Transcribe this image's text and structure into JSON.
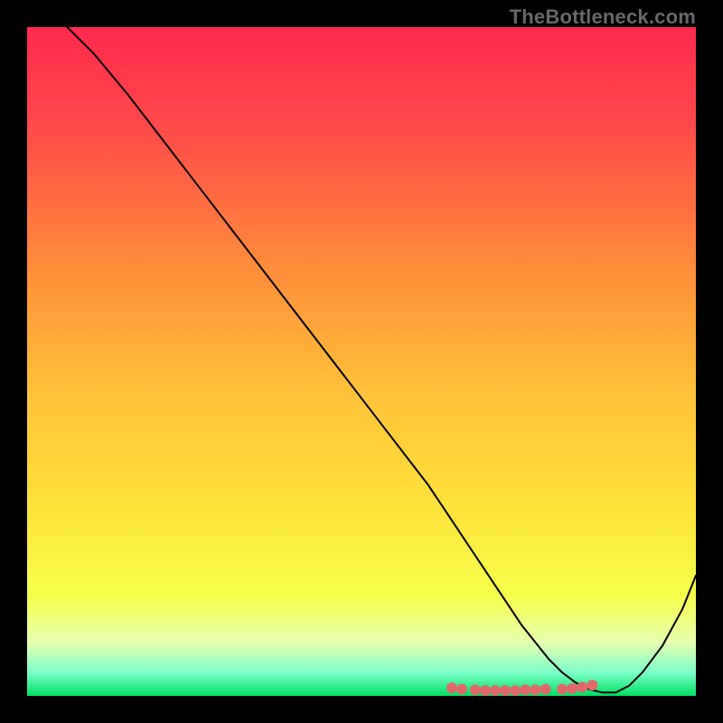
{
  "watermark": "TheBottleneck.com",
  "chart_data": {
    "type": "line",
    "title": "",
    "xlabel": "",
    "ylabel": "",
    "xlim": [
      0,
      100
    ],
    "ylim": [
      0,
      100
    ],
    "grid": false,
    "legend": false,
    "series": [
      {
        "name": "curve",
        "x": [
          6,
          10,
          15,
          20,
          25,
          30,
          35,
          40,
          45,
          50,
          55,
          60,
          63,
          66,
          68,
          70,
          72,
          74,
          76,
          78,
          80,
          82,
          84,
          86,
          88,
          90,
          92,
          95,
          98,
          100
        ],
        "y": [
          100,
          96,
          90,
          83.5,
          77,
          70.5,
          64,
          57.5,
          51,
          44.5,
          38,
          31.5,
          27,
          22.5,
          19.5,
          16.5,
          13.5,
          10.5,
          8,
          5.5,
          3.5,
          2,
          1,
          0.5,
          0.5,
          1.5,
          3.5,
          7.5,
          13,
          18
        ],
        "stroke": "#000000",
        "width": 2
      }
    ],
    "markers": {
      "name": "dots",
      "x": [
        63.5,
        65,
        67,
        68.5,
        70,
        71.5,
        73,
        74.5,
        76,
        77.5,
        80,
        81.5,
        83,
        84.5
      ],
      "y": [
        1.2,
        1.0,
        0.9,
        0.8,
        0.8,
        0.8,
        0.8,
        0.9,
        0.9,
        1.0,
        1.0,
        1.1,
        1.3,
        1.6
      ],
      "fill": "#e06a6a",
      "radius": 6
    },
    "gradient_stops": [
      {
        "p": 0.0,
        "c": "#ff2a4d"
      },
      {
        "p": 0.15,
        "c": "#ff4a4a"
      },
      {
        "p": 0.35,
        "c": "#ff8a3a"
      },
      {
        "p": 0.55,
        "c": "#ffc23a"
      },
      {
        "p": 0.72,
        "c": "#ffe33a"
      },
      {
        "p": 0.85,
        "c": "#f6ff4a"
      },
      {
        "p": 0.92,
        "c": "#e6ffb0"
      },
      {
        "p": 0.965,
        "c": "#7dffc9"
      },
      {
        "p": 1.0,
        "c": "#00e060"
      }
    ]
  }
}
